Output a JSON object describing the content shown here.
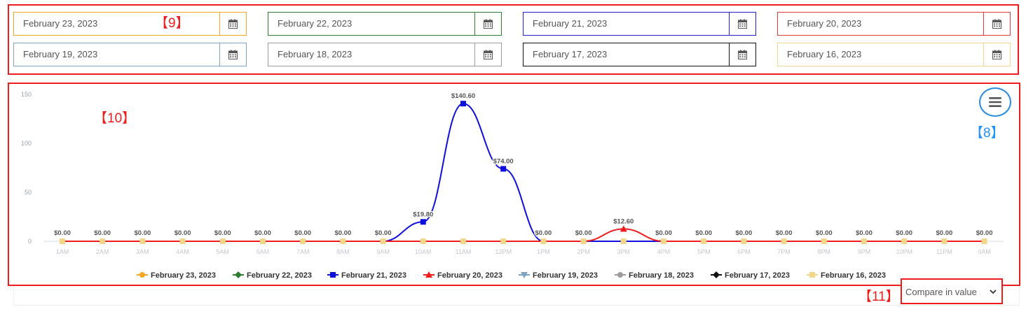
{
  "date_fields": [
    {
      "value": "February 23, 2023",
      "color": "#f5a623"
    },
    {
      "value": "February 22, 2023",
      "color": "#2e7d32"
    },
    {
      "value": "February 21, 2023",
      "color": "#2222cc"
    },
    {
      "value": "February 20, 2023",
      "color": "#e53935"
    },
    {
      "value": "February 19, 2023",
      "color": "#7aa3c4"
    },
    {
      "value": "February 18, 2023",
      "color": "#9e9a99"
    },
    {
      "value": "February 17, 2023",
      "color": "#111111"
    },
    {
      "value": "February 16, 2023",
      "color": "#f2d78a"
    }
  ],
  "annotations": {
    "dates": "【9】",
    "chart": "【10】",
    "menu": "【8】",
    "compare": "【11】"
  },
  "chart_menu_icon": "hamburger-icon",
  "compare_select": {
    "selected": "Compare in value",
    "icon": "chevron-down-icon"
  },
  "chart_data": {
    "type": "line",
    "categories": [
      "1AM",
      "2AM",
      "3AM",
      "4AM",
      "5AM",
      "6AM",
      "7AM",
      "8AM",
      "9AM",
      "10AM",
      "11AM",
      "12PM",
      "1PM",
      "2PM",
      "3PM",
      "4PM",
      "5PM",
      "6PM",
      "7PM",
      "8PM",
      "9PM",
      "10PM",
      "11PM",
      "0AM"
    ],
    "y_ticks": [
      "0",
      "50",
      "100",
      "150"
    ],
    "ylim": [
      0,
      150
    ],
    "grid": false,
    "legend_position": "bottom",
    "data_labels": [
      "$0.00",
      "$0.00",
      "$0.00",
      "$0.00",
      "$0.00",
      "$0.00",
      "$0.00",
      "$0.00",
      "$0.00",
      "$19.80",
      "$140.60",
      "$74.00",
      "$0.00",
      "$0.00",
      "$12.60",
      "$0.00",
      "$0.00",
      "$0.00",
      "$0.00",
      "$0.00",
      "$0.00",
      "$0.00",
      "$0.00",
      "$0.00"
    ],
    "series": [
      {
        "name": "February 23, 2023",
        "color": "#f5a623",
        "marker": "circle",
        "values": [
          0,
          0,
          0,
          0,
          0,
          0,
          0,
          0,
          0,
          0,
          0,
          0,
          0,
          0,
          0,
          0,
          0,
          0,
          0,
          0,
          0,
          0,
          0,
          0
        ]
      },
      {
        "name": "February 22, 2023",
        "color": "#2e7d32",
        "marker": "diamond",
        "values": [
          0,
          0,
          0,
          0,
          0,
          0,
          0,
          0,
          0,
          0,
          0,
          0,
          0,
          0,
          0,
          0,
          0,
          0,
          0,
          0,
          0,
          0,
          0,
          0
        ]
      },
      {
        "name": "February 21, 2023",
        "color": "#1010dd",
        "marker": "square",
        "values": [
          0,
          0,
          0,
          0,
          0,
          0,
          0,
          0,
          0,
          19.8,
          140.6,
          74,
          0,
          0,
          0,
          0,
          0,
          0,
          0,
          0,
          0,
          0,
          0,
          0
        ]
      },
      {
        "name": "February 20, 2023",
        "color": "#ee1c1c",
        "marker": "triangle",
        "values": [
          0,
          0,
          0,
          0,
          0,
          0,
          0,
          0,
          0,
          0,
          0,
          0,
          0,
          0,
          12.6,
          0,
          0,
          0,
          0,
          0,
          0,
          0,
          0,
          0
        ]
      },
      {
        "name": "February 19, 2023",
        "color": "#7aa3c4",
        "marker": "triangle-down",
        "values": [
          0,
          0,
          0,
          0,
          0,
          0,
          0,
          0,
          0,
          0,
          0,
          0,
          0,
          0,
          0,
          0,
          0,
          0,
          0,
          0,
          0,
          0,
          0,
          0
        ]
      },
      {
        "name": "February 18, 2023",
        "color": "#9e9a99",
        "marker": "circle",
        "values": [
          0,
          0,
          0,
          0,
          0,
          0,
          0,
          0,
          0,
          0,
          0,
          0,
          0,
          0,
          0,
          0,
          0,
          0,
          0,
          0,
          0,
          0,
          0,
          0
        ]
      },
      {
        "name": "February 17, 2023",
        "color": "#111111",
        "marker": "diamond",
        "values": [
          0,
          0,
          0,
          0,
          0,
          0,
          0,
          0,
          0,
          0,
          0,
          0,
          0,
          0,
          0,
          0,
          0,
          0,
          0,
          0,
          0,
          0,
          0,
          0
        ]
      },
      {
        "name": "February 16, 2023",
        "color": "#f2d78a",
        "marker": "square",
        "values": [
          0,
          0,
          0,
          0,
          0,
          0,
          0,
          0,
          0,
          0,
          0,
          0,
          0,
          0,
          0,
          0,
          0,
          0,
          0,
          0,
          0,
          0,
          0,
          0
        ]
      }
    ]
  }
}
